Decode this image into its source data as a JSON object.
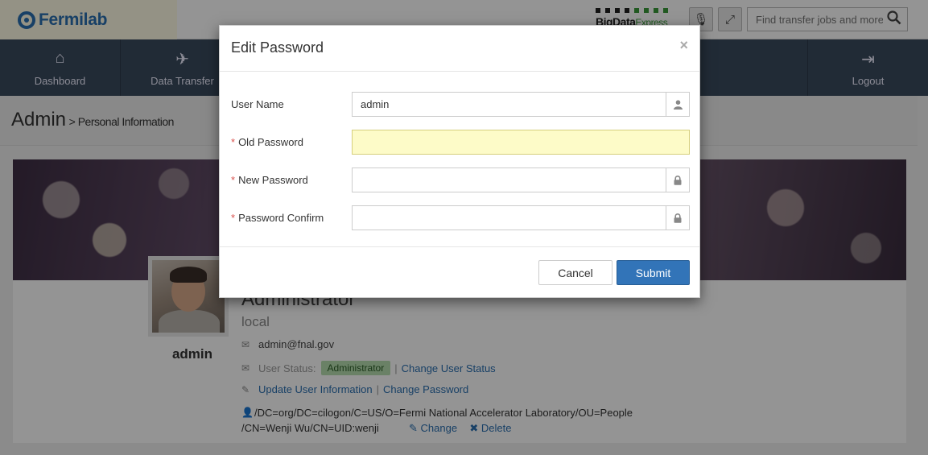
{
  "header": {
    "logo_text": "Fermilab",
    "bde_logo": {
      "text_main": "BigData",
      "text_sub": "Express"
    },
    "mic_icon": "microphone-icon",
    "fullscreen_icon": "expand-icon",
    "search": {
      "placeholder": "Find transfer jobs and more",
      "icon": "search-icon"
    }
  },
  "nav": {
    "items": [
      {
        "label": "Dashboard",
        "icon": "home-icon"
      },
      {
        "label": "Data Transfer",
        "icon": "paper-plane-icon"
      },
      {
        "label": "Logout",
        "icon": "logout-icon"
      }
    ]
  },
  "breadcrumb": {
    "section": "Admin",
    "page": "> Personal Information"
  },
  "profile": {
    "username": "admin",
    "role": "Administrator",
    "source": "local",
    "email": "admin@fnal.gov",
    "status_label": "User Status:",
    "status_value": "Administrator",
    "change_status_link": "Change User Status",
    "update_info_link": "Update User Information",
    "change_password_link": "Change Password",
    "dn_line1": "/DC=org/DC=cilogon/C=US/O=Fermi National Accelerator Laboratory/OU=People",
    "dn_line2": "/CN=Wenji Wu/CN=UID:wenji",
    "dn_change": "Change",
    "dn_delete": "Delete",
    "colors": {
      "badge_bg": "#b7dfb0",
      "link": "#2a6fb0"
    }
  },
  "modal": {
    "title": "Edit Password",
    "close_glyph": "×",
    "fields": [
      {
        "label": "User Name",
        "required": false,
        "value": "admin",
        "placeholder": "",
        "addon_icon": "user-icon",
        "focused": false
      },
      {
        "label": "Old Password",
        "required": true,
        "value": "",
        "placeholder": "",
        "addon_icon": "",
        "focused": true
      },
      {
        "label": "New Password",
        "required": true,
        "value": "",
        "placeholder": "",
        "addon_icon": "lock-icon",
        "focused": false
      },
      {
        "label": "Password Confirm",
        "required": true,
        "value": "",
        "placeholder": "",
        "addon_icon": "lock-icon",
        "focused": false
      }
    ],
    "required_mark": "*",
    "cancel_label": "Cancel",
    "submit_label": "Submit",
    "colors": {
      "submit_bg": "#3274b8",
      "focus_bg": "#fdfbc8",
      "required": "#d9534f"
    }
  }
}
